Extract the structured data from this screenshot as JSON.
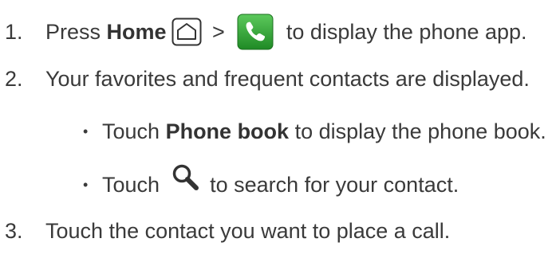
{
  "steps": [
    {
      "number": "1.",
      "text_before": "Press ",
      "bold": "Home",
      "separator": " > ",
      "text_after": " to display the phone app."
    },
    {
      "number": "2.",
      "text": "Your favorites and frequent contacts are displayed."
    },
    {
      "number": "3.",
      "text": "Touch the contact you want to place a call."
    }
  ],
  "bullets": [
    {
      "symbol": "•",
      "text_before": "Touch ",
      "bold": "Phone book",
      "text_after": " to display the phone book."
    },
    {
      "symbol": "•",
      "text_before": "Touch ",
      "text_after": " to search for your contact."
    }
  ],
  "icons": {
    "home": "home-icon",
    "phone": "phone-app-icon",
    "search": "search-icon"
  },
  "colors": {
    "text": "#3a3a3a",
    "phone_icon_green": "#2f9a2f"
  }
}
